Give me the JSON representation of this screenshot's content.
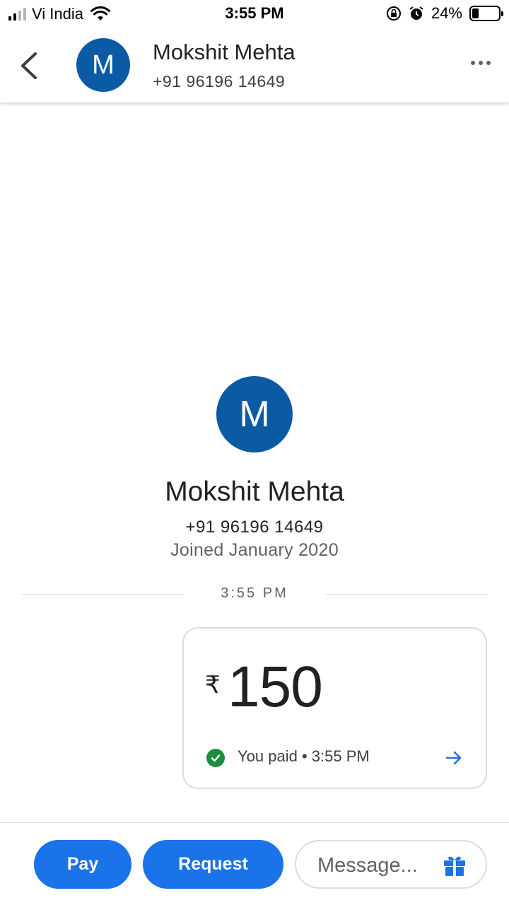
{
  "status_bar": {
    "carrier": "Vi India",
    "time": "3:55 PM",
    "battery_percent": "24%",
    "signal_bars_active": 2,
    "signal_bars_total": 4
  },
  "header": {
    "avatar_initial": "M",
    "name": "Mokshit Mehta",
    "phone": "+91 96196 14649",
    "back_icon": "chevron-left-icon",
    "more_icon": "more-horizontal-icon"
  },
  "profile": {
    "avatar_initial": "M",
    "name": "Mokshit Mehta",
    "phone": "+91 96196 14649",
    "joined": "Joined January 2020"
  },
  "thread": {
    "divider_time": "3:55 PM",
    "payment": {
      "currency_symbol": "₹",
      "amount": "150",
      "status": "You paid • 3:55 PM",
      "status_icon": "check-circle-icon",
      "arrow_icon": "arrow-right-icon"
    }
  },
  "bottom_bar": {
    "pay_label": "Pay",
    "request_label": "Request",
    "message_placeholder": "Message...",
    "gift_icon": "gift-icon"
  },
  "colors": {
    "avatar_bg": "#0b5aa4",
    "primary_button": "#1a73e8",
    "success": "#1e8e3e",
    "link_arrow": "#1a73e8"
  }
}
